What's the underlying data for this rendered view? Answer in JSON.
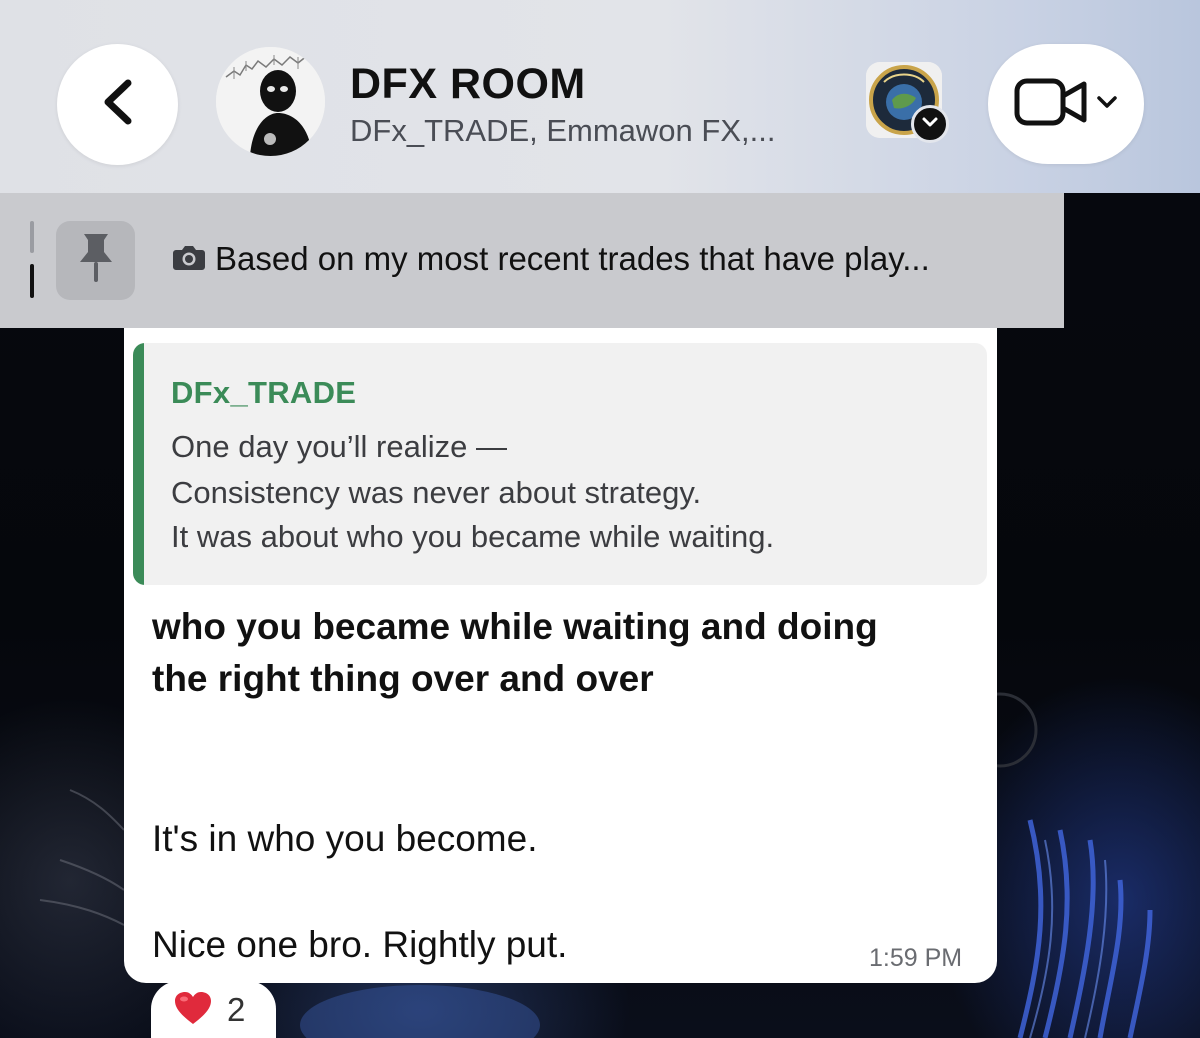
{
  "header": {
    "title": "DFX ROOM",
    "subtitle": "DFx_TRADE, Emmawon FX,...",
    "avatar_icon": "group-avatar-masked-figure",
    "community_icon": "community-avatar-globe-badge",
    "back_icon": "chevron-left-icon",
    "video_icon": "video-camera-icon",
    "video_menu_icon": "chevron-down-icon"
  },
  "pinned": {
    "icon": "pin-icon",
    "media_icon": "camera-icon",
    "text": "Based on my most recent trades that have play..."
  },
  "message": {
    "quote": {
      "author": "DFx_TRADE",
      "lines": [
        "One day you’ll realize —",
        "Consistency was never about strategy.",
        "It was about who you became while waiting."
      ]
    },
    "bold_lines": [
      "who you became while waiting and doing",
      "the right thing over and over"
    ],
    "plain_lines": [
      "It's in who you become.",
      "Nice one bro. Rightly put."
    ],
    "time": "1:59 PM"
  },
  "reaction": {
    "icon": "heart-icon",
    "count": "2"
  },
  "colors": {
    "header_bg": "#e2e4e9",
    "pinned_bg": "#c9cace",
    "quote_accent": "#3b8b58",
    "bubble_bg": "#ffffff",
    "heart": "#e02a3c"
  }
}
